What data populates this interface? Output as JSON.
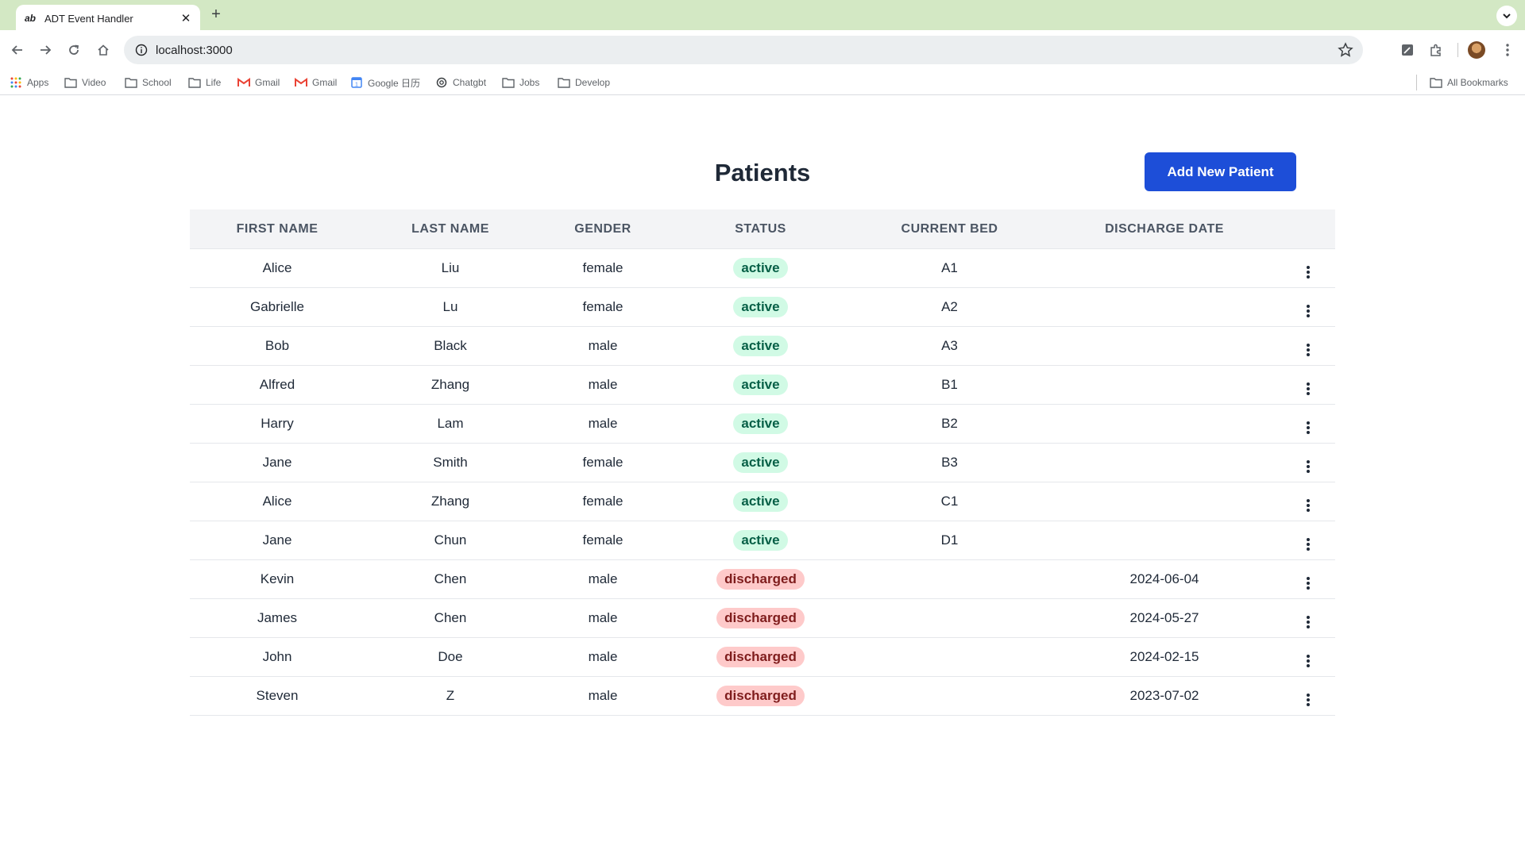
{
  "browser": {
    "tab_title": "ADT Event Handler",
    "tab_favicon": "ab",
    "url": "localhost:3000",
    "bookmarks": [
      {
        "label": "Apps",
        "icon": "apps-grid-icon"
      },
      {
        "label": "Video",
        "icon": "folder-icon"
      },
      {
        "label": "School",
        "icon": "folder-icon"
      },
      {
        "label": "Life",
        "icon": "folder-icon"
      },
      {
        "label": "Gmail",
        "icon": "gmail-icon"
      },
      {
        "label": "Gmail",
        "icon": "gmail-icon"
      },
      {
        "label": "Google 日历",
        "icon": "calendar-icon"
      },
      {
        "label": "Chatgbt",
        "icon": "chatgpt-icon"
      },
      {
        "label": "Jobs",
        "icon": "folder-icon"
      },
      {
        "label": "Develop",
        "icon": "folder-icon"
      }
    ],
    "all_bookmarks": "All Bookmarks",
    "tab_bar_color": "#d3e8c4"
  },
  "page": {
    "title": "Patients",
    "add_button": "Add New Patient",
    "accent_color": "#1d4ed8"
  },
  "table": {
    "headers": [
      "FIRST NAME",
      "LAST NAME",
      "GENDER",
      "STATUS",
      "CURRENT BED",
      "DISCHARGE DATE"
    ],
    "rows": [
      {
        "first": "Alice",
        "last": "Liu",
        "gender": "female",
        "status": "active",
        "bed": "A1",
        "discharge": ""
      },
      {
        "first": "Gabrielle",
        "last": "Lu",
        "gender": "female",
        "status": "active",
        "bed": "A2",
        "discharge": ""
      },
      {
        "first": "Bob",
        "last": "Black",
        "gender": "male",
        "status": "active",
        "bed": "A3",
        "discharge": ""
      },
      {
        "first": "Alfred",
        "last": "Zhang",
        "gender": "male",
        "status": "active",
        "bed": "B1",
        "discharge": ""
      },
      {
        "first": "Harry",
        "last": "Lam",
        "gender": "male",
        "status": "active",
        "bed": "B2",
        "discharge": ""
      },
      {
        "first": "Jane",
        "last": "Smith",
        "gender": "female",
        "status": "active",
        "bed": "B3",
        "discharge": ""
      },
      {
        "first": "Alice",
        "last": "Zhang",
        "gender": "female",
        "status": "active",
        "bed": "C1",
        "discharge": ""
      },
      {
        "first": "Jane",
        "last": "Chun",
        "gender": "female",
        "status": "active",
        "bed": "D1",
        "discharge": ""
      },
      {
        "first": "Kevin",
        "last": "Chen",
        "gender": "male",
        "status": "discharged",
        "bed": "",
        "discharge": "2024-06-04"
      },
      {
        "first": "James",
        "last": "Chen",
        "gender": "male",
        "status": "discharged",
        "bed": "",
        "discharge": "2024-05-27"
      },
      {
        "first": "John",
        "last": "Doe",
        "gender": "male",
        "status": "discharged",
        "bed": "",
        "discharge": "2024-02-15"
      },
      {
        "first": "Steven",
        "last": "Z",
        "gender": "male",
        "status": "discharged",
        "bed": "",
        "discharge": "2023-07-02"
      }
    ],
    "status_colors": {
      "active": "#d1fae5",
      "discharged": "#fecaca"
    }
  }
}
